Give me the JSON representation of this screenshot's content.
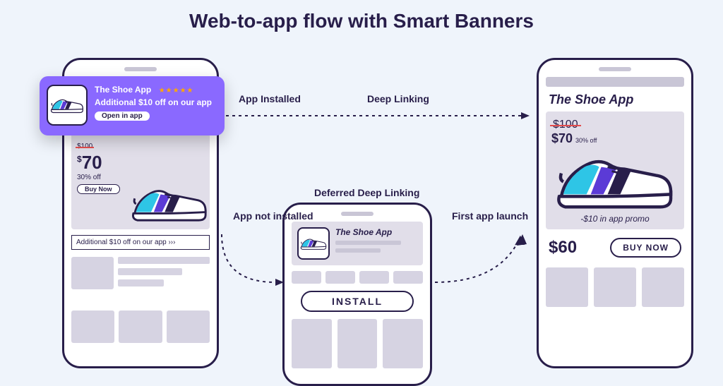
{
  "title": "Web-to-app flow with Smart Banners",
  "flow": {
    "installed_label": "App Installed",
    "deep_link_label": "Deep Linking",
    "not_installed_label": "App not installed",
    "deferred_label": "Deferred Deep Linking",
    "first_launch_label": "First app launch"
  },
  "smart_banner": {
    "app_name": "The Shoe App",
    "stars": "★★★★★",
    "promo_line": "Additional $10 off on our app",
    "open_cta": "Open in app"
  },
  "web_view": {
    "price_original": "$100",
    "price_discounted_currency": "$",
    "price_discounted_value": "70",
    "discount_label": "30% off",
    "buy_cta": "Buy Now",
    "inline_banner": "Additional $10 off on our app ›››"
  },
  "app_store": {
    "app_name": "The Shoe App",
    "install_cta": "INSTALL"
  },
  "app_view": {
    "app_name": "The Shoe App",
    "price_original": "$100",
    "price_discounted": "$70",
    "discount_label": "30% off",
    "promo_line": "-$10 in app promo",
    "price_final": "$60",
    "buy_cta": "BUY NOW"
  },
  "colors": {
    "navy": "#281E4A",
    "purple": "#7E5BEF",
    "orange": "#FFA800",
    "red": "#E24C4C",
    "background": "#EFF4FB"
  }
}
